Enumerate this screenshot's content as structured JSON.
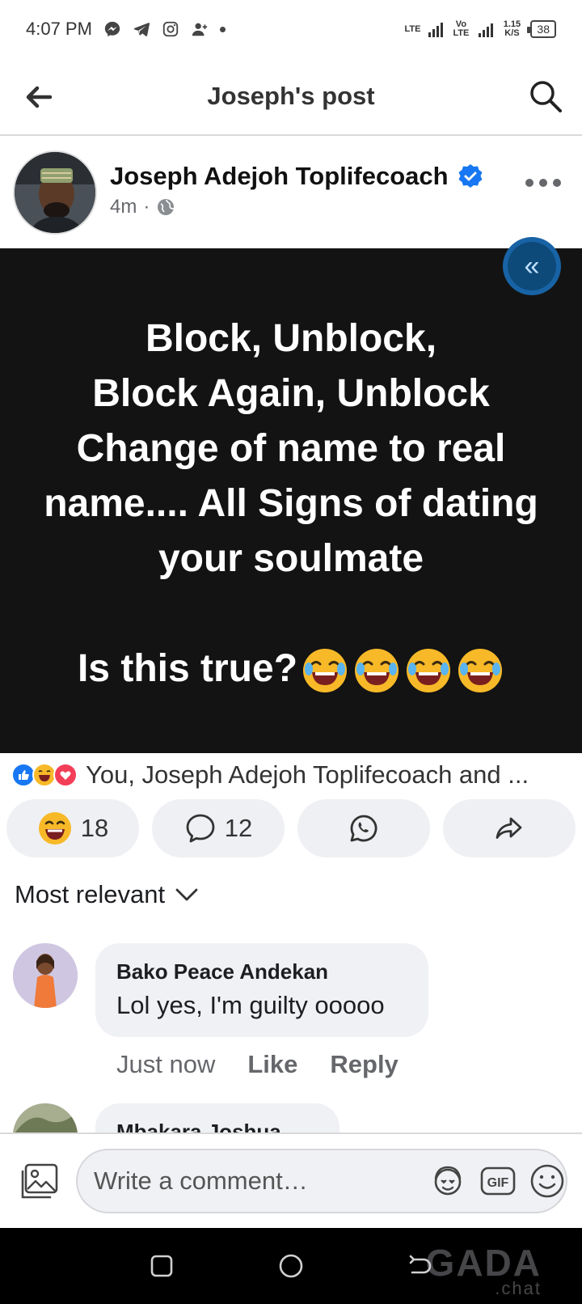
{
  "status_bar": {
    "time": "4:07 PM",
    "net_label_1": "LTE",
    "net_label_2": "Vo LTE",
    "speed": "1.15 K/S",
    "battery": "38",
    "icons": [
      "messenger-icon",
      "telegram-icon",
      "instagram-icon",
      "person-add-icon"
    ]
  },
  "header": {
    "title": "Joseph's post"
  },
  "post": {
    "author": "Joseph Adejoh Toplifecoach",
    "time": "4m",
    "body": "Block, Unblock,\nBlock Again, Unblock\nChange of name to real\nname.... All Signs of dating\nyour soulmate\n\nIs this true?",
    "collapse_glyph": "«",
    "reactions_text": "You, Joseph Adejoh Toplifecoach and ...",
    "reaction_count": "18",
    "comment_count": "12"
  },
  "comments": {
    "sort_label": "Most relevant",
    "items": [
      {
        "name": "Bako Peace Andekan",
        "text": "Lol yes, I'm guilty ooooo",
        "time": "Just now",
        "like_label": "Like",
        "reply_label": "Reply"
      },
      {
        "name": "Mbakara Joshua"
      }
    ]
  },
  "composer": {
    "placeholder": "Write a comment…",
    "gif_label": "GIF"
  },
  "watermark": {
    "main": "GADA",
    "sub": ".chat"
  },
  "colors": {
    "accent": "#1877f2",
    "post_bg": "#131313",
    "bubble_bg": "#f0f1f4"
  }
}
